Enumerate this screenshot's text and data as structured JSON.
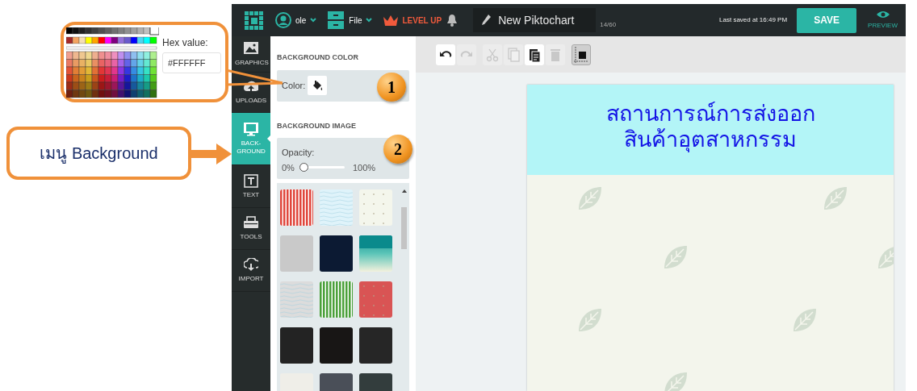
{
  "annotations": {
    "color_picker": {
      "hex_label": "Hex value:",
      "hex_value": "#FFFFFF"
    },
    "menu_callout": "เมนู Background",
    "badges": [
      "1",
      "2"
    ]
  },
  "top_bar": {
    "user": "ole",
    "file": "File",
    "level_up": "LEVEL UP",
    "title": "New Piktochart",
    "char_count": "14/60",
    "last_saved": "Last saved at 16:49 PM",
    "save": "SAVE",
    "preview": "PREVIEW"
  },
  "sidebar": {
    "items": [
      {
        "kind": "graphics",
        "label": "GRAPHICS",
        "selected": false
      },
      {
        "kind": "uploads",
        "label": "UPLOADS",
        "selected": false
      },
      {
        "kind": "background",
        "label": "BACK-GROUND",
        "selected": true
      },
      {
        "kind": "text",
        "label": "TEXT",
        "selected": false
      },
      {
        "kind": "tools",
        "label": "TOOLS",
        "selected": false
      },
      {
        "kind": "import",
        "label": "IMPORT",
        "selected": false
      }
    ]
  },
  "panel": {
    "color_heading": "BACKGROUND COLOR",
    "color_label": "Color:",
    "image_heading": "BACKGROUND IMAGE",
    "opacity_label": "Opacity:",
    "opacity_min": "0%",
    "opacity_max": "100%",
    "opacity_slider": {
      "level": 0
    },
    "images": [
      {
        "kind": "stripes",
        "color": "#e0463c"
      },
      {
        "kind": "waves",
        "color": "#dff3fa"
      },
      {
        "kind": "dots",
        "color": "#f4f6ec"
      },
      {
        "kind": "plain",
        "color": "#c9c9c9"
      },
      {
        "kind": "plain",
        "color": "#0c1a33"
      },
      {
        "kind": "gradient",
        "color": "#0a8a8c"
      },
      {
        "kind": "waves",
        "color": "#dcdcdc"
      },
      {
        "kind": "stripes",
        "color": "#4aa03a"
      },
      {
        "kind": "dots",
        "color": "#d95454"
      },
      {
        "kind": "plain",
        "color": "#232323"
      },
      {
        "kind": "plain",
        "color": "#181615"
      },
      {
        "kind": "plain",
        "color": "#262626"
      },
      {
        "kind": "plain",
        "color": "#efeee8"
      },
      {
        "kind": "plain",
        "color": "#4a4f58"
      },
      {
        "kind": "plain",
        "color": "#333d3d"
      }
    ]
  },
  "toolbar": {
    "snap_on": true,
    "tools": [
      {
        "kind": "undo",
        "disabled": false
      },
      {
        "kind": "redo",
        "disabled": true
      },
      {
        "kind": "cut",
        "disabled": true
      },
      {
        "kind": "copy",
        "disabled": true
      },
      {
        "kind": "paste",
        "disabled": false
      },
      {
        "kind": "trash",
        "disabled": true
      }
    ]
  },
  "canvas": {
    "title_lines": [
      "สถานการณ์การส่งออก",
      "สินค้าอุตสาหกรรม"
    ]
  }
}
